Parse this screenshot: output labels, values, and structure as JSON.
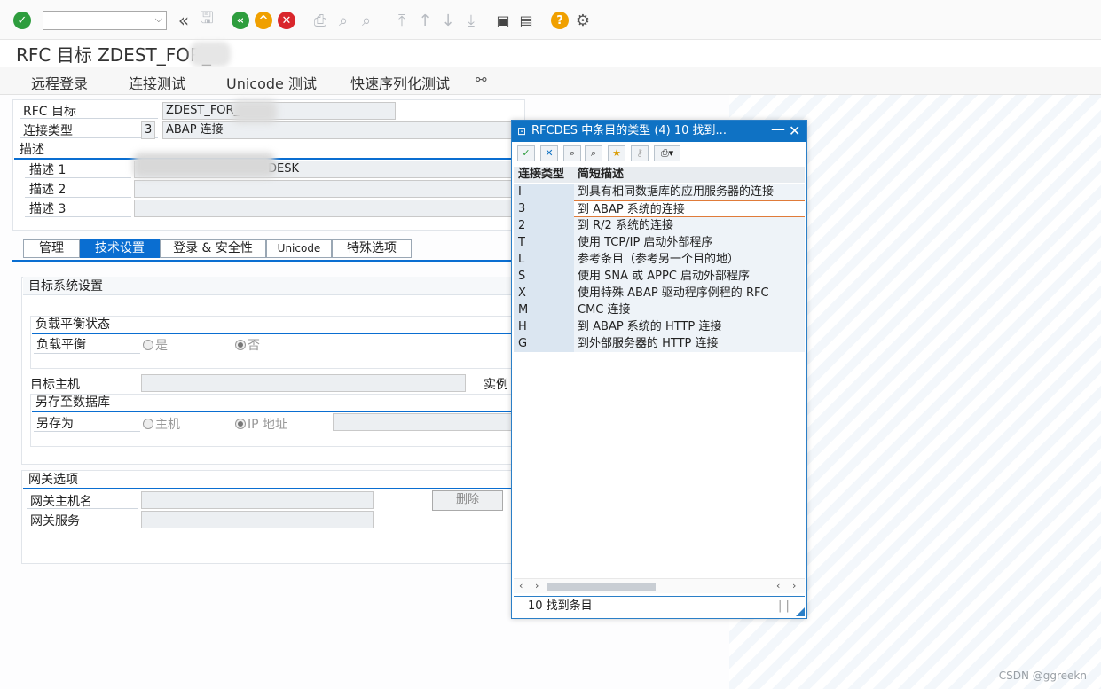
{
  "title": "RFC 目标 ZDEST_FOR_",
  "menu": [
    "远程登录",
    "连接测试",
    "Unicode 测试",
    "快速序列化测试"
  ],
  "icons": {
    "enter": "checkmark-icon",
    "save": "save-icon",
    "back": "back-icon",
    "exit": "exit-icon",
    "cancel": "cancel-icon",
    "help": "help-icon"
  },
  "fields": {
    "rfc_dest_label": "RFC 目标",
    "rfc_dest_value": "ZDEST_FOR_",
    "conn_type_label": "连接类型",
    "conn_type_code": "3",
    "conn_type_desc": "ABAP 连接",
    "desc_section": "描述",
    "desc1_label": "描述 1",
    "desc1_value": "DESK",
    "desc2_label": "描述 2",
    "desc3_label": "描述 3"
  },
  "tabs": [
    "管理",
    "技术设置",
    "登录 & 安全性",
    "Unicode",
    "特殊选项"
  ],
  "active_tab": "技术设置",
  "target_system": {
    "section": "目标系统设置",
    "lb_status": "负载平衡状态",
    "lb_label": "负载平衡",
    "yes": "是",
    "no": "否",
    "target_host": "目标主机",
    "instance": "实例",
    "save_db": "另存至数据库",
    "save_as": "另存为",
    "host": "主机",
    "ip": "IP 地址"
  },
  "gateway": {
    "section": "网关选项",
    "host_label": "网关主机名",
    "service_label": "网关服务",
    "delete_button": "删除"
  },
  "popup": {
    "title": "RFCDES 中条目的类型 (4)   10 找到...",
    "col_key": "连接类型",
    "col_desc": "简短描述",
    "rows": [
      {
        "k": "I",
        "v": "到具有相同数据库的应用服务器的连接"
      },
      {
        "k": "3",
        "v": "到 ABAP 系统的连接"
      },
      {
        "k": "2",
        "v": "到 R/2 系统的连接"
      },
      {
        "k": "T",
        "v": "使用 TCP/IP 启动外部程序"
      },
      {
        "k": "L",
        "v": "参考条目（参考另一个目的地）"
      },
      {
        "k": "S",
        "v": "使用 SNA 或 APPC 启动外部程序"
      },
      {
        "k": "X",
        "v": "使用特殊 ABAP 驱动程序例程的 RFC"
      },
      {
        "k": "M",
        "v": "CMC 连接"
      },
      {
        "k": "H",
        "v": "到 ABAP 系统的 HTTP 连接"
      },
      {
        "k": "G",
        "v": "到外部服务器的 HTTP 连接"
      }
    ],
    "status": "10 找到条目"
  },
  "watermark": "CSDN @ggreekn"
}
